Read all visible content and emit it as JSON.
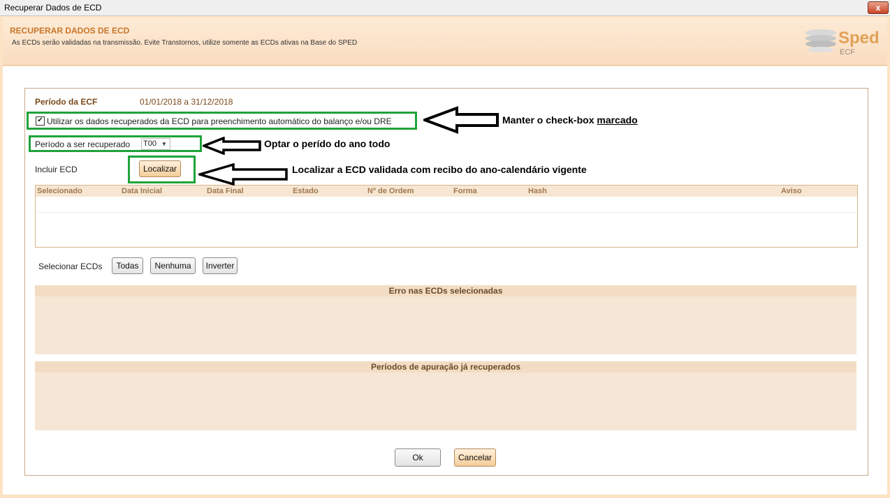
{
  "window": {
    "title": "Recuperar Dados de ECD",
    "close_label": "x"
  },
  "header": {
    "title": "RECUPERAR DADOS DE ECD",
    "description": "As ECDs serão validadas na transmissão. Evite Transtornos, utilize somente as ECDs ativas na Base do SPED",
    "logo_main": "Sped",
    "logo_sub": "ECF"
  },
  "form": {
    "period_label": "Período da ECF",
    "period_value": "01/01/2018 a 31/12/2018",
    "use_data_checkbox_label": "Utilizar os dados recuperados da ECD para preenchimento automático do balanço e/ou DRE",
    "use_data_checked": true,
    "period_recovered_label": "Período a ser recuperado",
    "period_recovered_value": "T00",
    "include_label": "Incluir ECD",
    "locate_button": "Localizar"
  },
  "table": {
    "columns": [
      "Selecionado",
      "Data Inicial",
      "Data Final",
      "Estado",
      "Nº de Ordem",
      "Forma",
      "Hash",
      "Aviso"
    ],
    "rows": []
  },
  "select_ecds": {
    "label": "Selecionar ECDs",
    "all": "Todas",
    "none": "Nenhuma",
    "invert": "Inverter"
  },
  "errors_section": {
    "title": "Erro nas ECDs selecionadas"
  },
  "periods_section": {
    "title": "Períodos de apuração já recuperados"
  },
  "footer": {
    "ok": "Ok",
    "cancel": "Cancelar"
  },
  "annotations": {
    "keep_checkbox_prefix": "Manter o check-box ",
    "keep_checkbox_emph": "marcado",
    "choose_period": "Optar o perído do ano todo",
    "locate_ecd": "Localizar a ECD validada com recibo do ano-calendário vigente"
  },
  "colors": {
    "accent": "#1fa33a",
    "brand": "#c8762a",
    "background": "#fbe3c4"
  }
}
